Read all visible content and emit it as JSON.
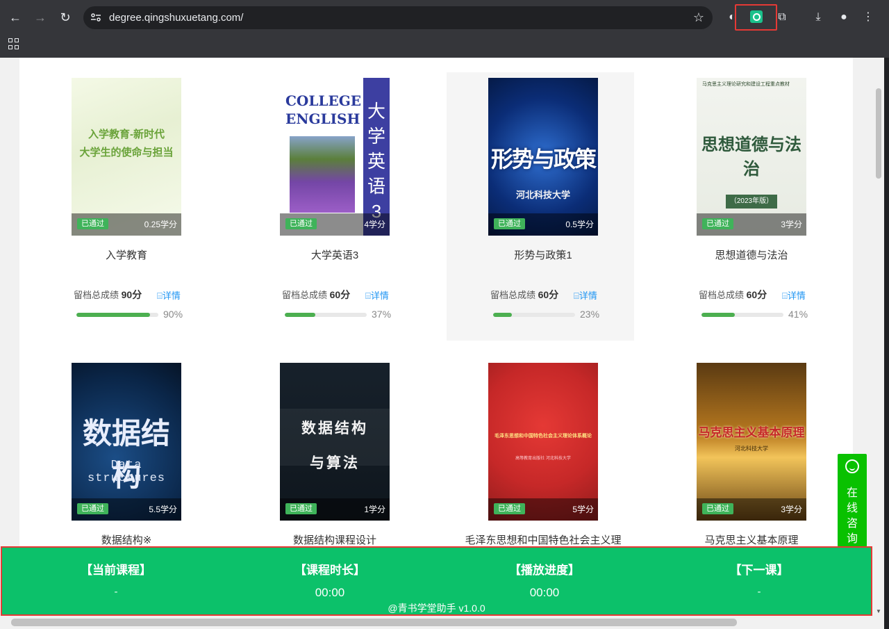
{
  "browser": {
    "url": "degree.qingshuxuetang.com/",
    "icons": [
      "back-icon",
      "forward-icon",
      "reload-icon",
      "site-info-icon",
      "star-icon",
      "extension-icon",
      "puzzle-icon",
      "download-icon",
      "profile-icon",
      "menu-icon",
      "apps-icon"
    ]
  },
  "courses": [
    {
      "name": "入学教育",
      "credit": "0.25学分",
      "badge": "已通过",
      "score_label": "留档总成绩",
      "score": "90分",
      "detail": "详情",
      "progress": 90,
      "progress_text": "90%",
      "cover_lines": [
        "入学教育-新时代",
        "大学生的使命与担当"
      ]
    },
    {
      "name": "大学英语3",
      "credit": "4学分",
      "badge": "已通过",
      "score_label": "留档总成绩",
      "score": "60分",
      "detail": "详情",
      "progress": 37,
      "progress_text": "37%",
      "cover_lines": [
        "COLLEGE",
        "ENGLISH",
        "大",
        "学",
        "英",
        "语",
        "3"
      ]
    },
    {
      "name": "形势与政策1",
      "credit": "0.5学分",
      "badge": "已通过",
      "score_label": "留档总成绩",
      "score": "60分",
      "detail": "详情",
      "progress": 23,
      "progress_text": "23%",
      "cover_lines": [
        "形势与政策",
        "河北科技大学"
      ]
    },
    {
      "name": "思想道德与法治",
      "credit": "3学分",
      "badge": "已通过",
      "score_label": "留档总成绩",
      "score": "60分",
      "detail": "详情",
      "progress": 41,
      "progress_text": "41%",
      "cover_lines": [
        "马克思主义理论研究和建设工程重点教材",
        "思想道德与法治",
        "（2023年版）"
      ]
    },
    {
      "name": "数据结构※",
      "credit": "5.5学分",
      "badge": "已通过",
      "cover_lines": [
        "数据结构",
        "Data structures"
      ]
    },
    {
      "name": "数据结构课程设计",
      "credit": "1学分",
      "badge": "已通过",
      "cover_lines": [
        "数据结构",
        "与算法"
      ]
    },
    {
      "name": "毛泽东思想和中国特色社会主义理",
      "credit": "5学分",
      "badge": "已通过",
      "cover_lines": [
        "毛泽东思想和中国特色社会主义理论体系概论",
        "高等教育出版社 河北科技大学"
      ]
    },
    {
      "name": "马克思主义基本原理",
      "credit": "3学分",
      "badge": "已通过",
      "cover_lines": [
        "马克思主义基本原理",
        "河北科技大学"
      ]
    }
  ],
  "consult": {
    "chars": [
      "在",
      "线",
      "咨",
      "询"
    ]
  },
  "helper": {
    "current_course_label": "【当前课程】",
    "current_course_value": "-",
    "duration_label": "【课程时长】",
    "duration_value": "00:00",
    "progress_label": "【播放进度】",
    "progress_value": "00:00",
    "next_label": "【下一课】",
    "next_value": "-",
    "footer": "@青书学堂助手 v1.0.0"
  },
  "colors": {
    "accent_green": "#0cc16a",
    "pass_badge": "#3fb35a",
    "link_blue": "#2196f3",
    "consult_green": "#09c100",
    "highlight_red": "#e53935"
  }
}
